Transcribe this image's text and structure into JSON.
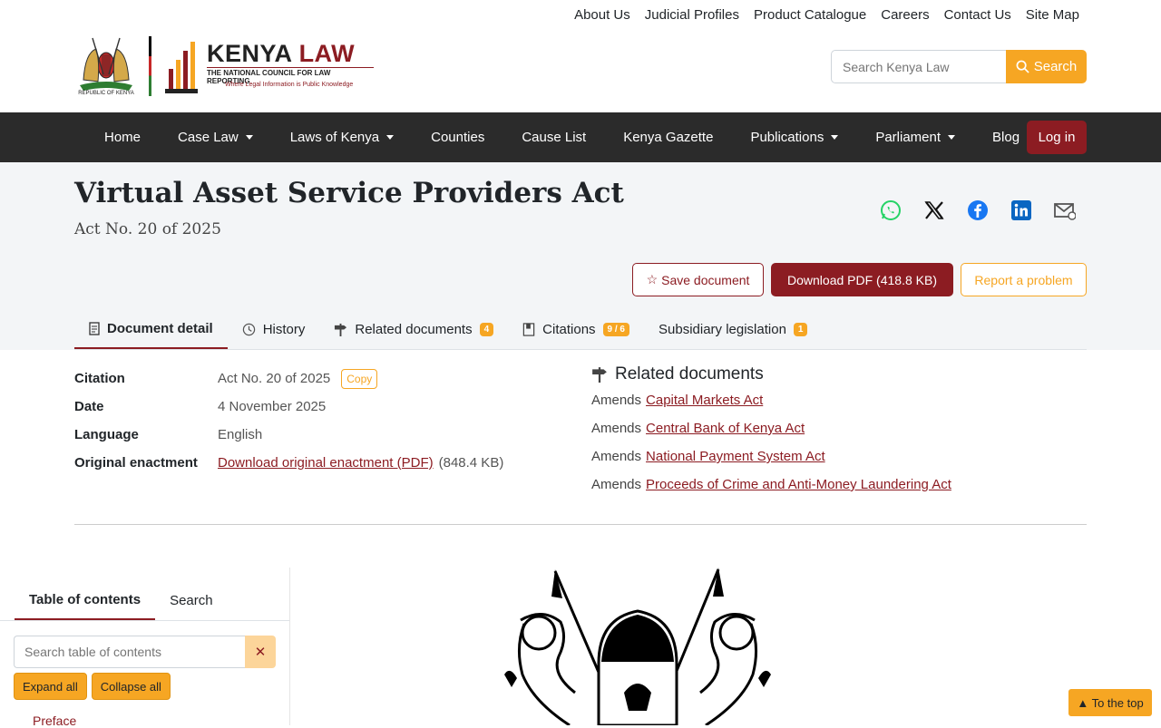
{
  "header": {
    "brand_name_1": "KENYA",
    "brand_name_2": "LAW",
    "brand_subtitle": "THE NATIONAL COUNCIL FOR LAW REPORTING",
    "brand_tagline": "Where Legal Information is Public Knowledge",
    "arms_caption": "REPUBLIC OF KENYA",
    "top_links": [
      "About Us",
      "Judicial Profiles",
      "Product Catalogue",
      "Careers",
      "Contact Us",
      "Site Map"
    ],
    "search": {
      "placeholder": "Search Kenya Law",
      "button_label": "Search"
    }
  },
  "nav": {
    "items": [
      {
        "label": "Home",
        "dropdown": false
      },
      {
        "label": "Case Law",
        "dropdown": true
      },
      {
        "label": "Laws of Kenya",
        "dropdown": true
      },
      {
        "label": "Counties",
        "dropdown": false
      },
      {
        "label": "Cause List",
        "dropdown": false
      },
      {
        "label": "Kenya Gazette",
        "dropdown": false
      },
      {
        "label": "Publications",
        "dropdown": true
      },
      {
        "label": "Parliament",
        "dropdown": true
      },
      {
        "label": "Blog",
        "dropdown": false
      }
    ],
    "login_label": "Log in"
  },
  "document": {
    "title": "Virtual Asset Service Providers Act",
    "subtitle": "Act No. 20 of 2025",
    "share_icons": [
      "whatsapp-icon",
      "x-icon",
      "facebook-icon",
      "linkedin-icon",
      "email-icon"
    ],
    "actions": {
      "save_label": "Save document",
      "download_label": "Download PDF (418.8  KB)",
      "report_label": "Report a problem"
    },
    "tabs": [
      {
        "label": "Document detail",
        "badge": ""
      },
      {
        "label": "History",
        "badge": ""
      },
      {
        "label": "Related documents",
        "badge": "4"
      },
      {
        "label": "Citations",
        "badge": "9 / 6"
      },
      {
        "label": "Subsidiary legislation",
        "badge": "1"
      }
    ],
    "details": {
      "citation_label": "Citation",
      "citation_value": "Act No. 20 of 2025",
      "copy_label": "Copy",
      "date_label": "Date",
      "date_value": "4 November 2025",
      "language_label": "Language",
      "language_value": "English",
      "enactment_label": "Original enactment",
      "enactment_link": "Download original enactment (PDF)",
      "enactment_size": "(848.4  KB)"
    },
    "related": {
      "heading": "Related documents",
      "items": [
        {
          "prefix": "Amends",
          "link": "Capital Markets Act"
        },
        {
          "prefix": "Amends",
          "link": "Central Bank of Kenya Act"
        },
        {
          "prefix": "Amends",
          "link": "National Payment System Act"
        },
        {
          "prefix": "Amends",
          "link": "Proceeds of Crime and Anti-Money Laundering Act"
        }
      ]
    }
  },
  "toc": {
    "tab_toc": "Table of contents",
    "tab_search": "Search",
    "search_placeholder": "Search table of contents",
    "clear_symbol": "✕",
    "expand_label": "Expand all",
    "collapse_label": "Collapse all",
    "first_item": "Preface"
  },
  "to_top_label": "▲ To the top",
  "colors": {
    "brand": "#8c1c22",
    "accent": "#f6a623",
    "nav_bg": "#2b2b2b",
    "band_bg": "#f3f5f7"
  }
}
